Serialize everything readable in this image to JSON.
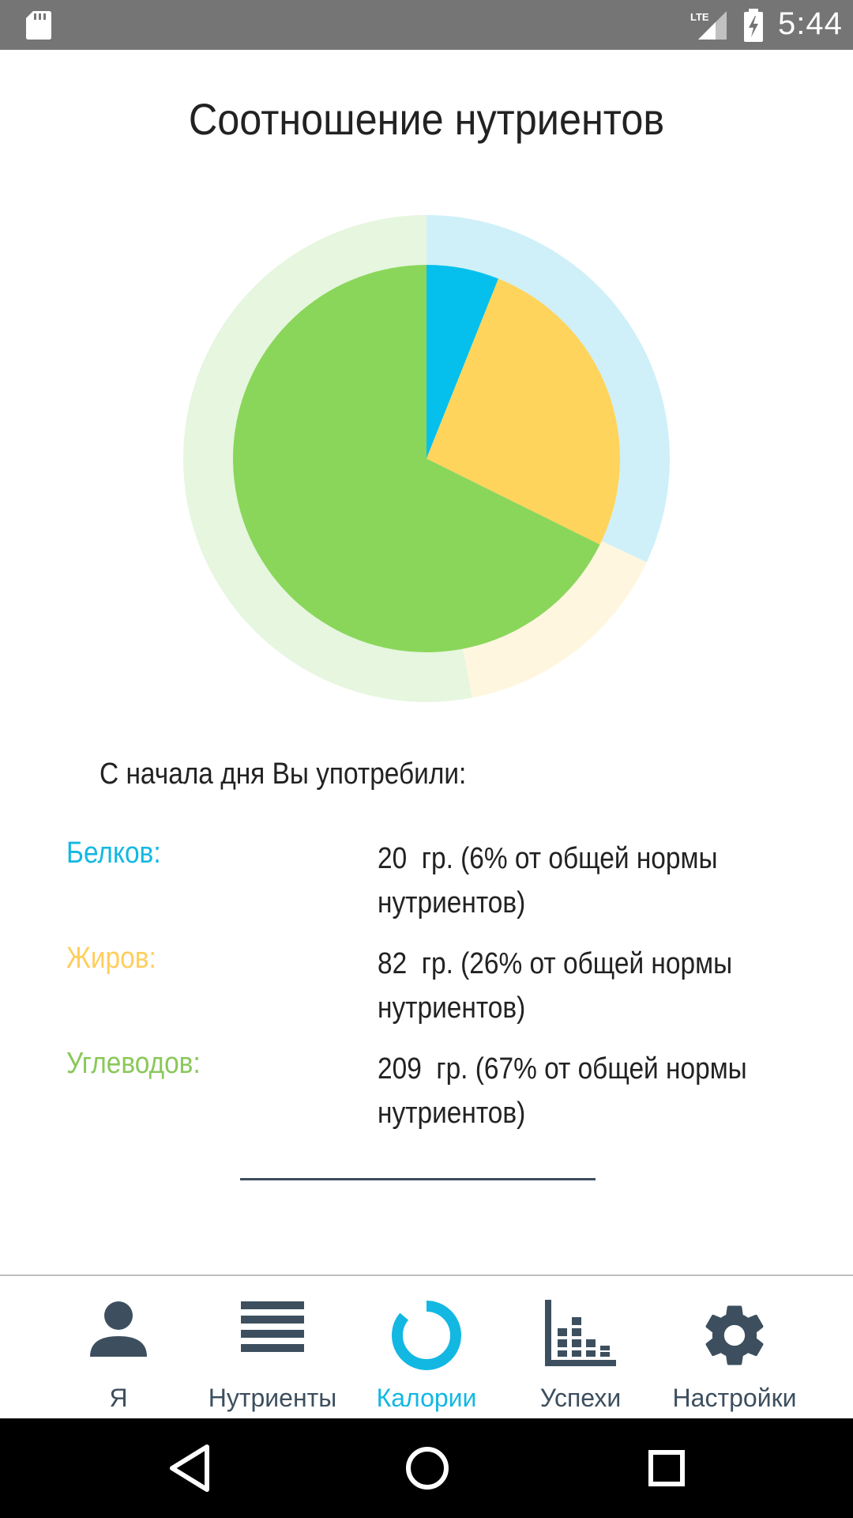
{
  "status_bar": {
    "network": "LTE",
    "time": "5:44",
    "icons": [
      "sd-card-icon",
      "signal-icon",
      "battery-charging-icon"
    ]
  },
  "title": "Соотношение нутриентов",
  "chart_data": {
    "type": "pie",
    "inner": {
      "labels": [
        "Белков",
        "Жиров",
        "Углеводов"
      ],
      "values": [
        6,
        26,
        67
      ],
      "colors": [
        "#05c0ec",
        "#ffd45c",
        "#8ad65b"
      ]
    },
    "outer_ring": {
      "values": [
        32,
        15,
        53
      ],
      "colors": [
        "#cff0f8",
        "#fff6df",
        "#e6f6df"
      ]
    }
  },
  "summary": {
    "intro": "С начала дня Вы употребили:",
    "rows": [
      {
        "label": "Белков:",
        "value_line1": "20  гр. (6% от общей нормы",
        "value_line2": "нутриентов)",
        "color": "#12b8e2"
      },
      {
        "label": "Жиров:",
        "value_line1": "82  гр. (26% от общей нормы",
        "value_line2": "нутриентов)",
        "color": "#ffce5c"
      },
      {
        "label": "Углеводов:",
        "value_line1": "209  гр. (67% от общей нормы",
        "value_line2": "нутриентов)",
        "color": "#8ac85a"
      }
    ]
  },
  "bottom_nav": {
    "items": [
      {
        "label": "Я",
        "icon": "person-icon",
        "active": false
      },
      {
        "label": "Нутриенты",
        "icon": "list-icon",
        "active": false
      },
      {
        "label": "Калории",
        "icon": "donut-icon",
        "active": true
      },
      {
        "label": "Успехи",
        "icon": "bar-chart-icon",
        "active": false
      },
      {
        "label": "Настройки",
        "icon": "gear-icon",
        "active": false
      }
    ],
    "active_color": "#12b8e2",
    "inactive_color": "#3d4f5e"
  },
  "system_nav": {
    "buttons": [
      "back-icon",
      "home-icon",
      "recents-icon"
    ]
  }
}
